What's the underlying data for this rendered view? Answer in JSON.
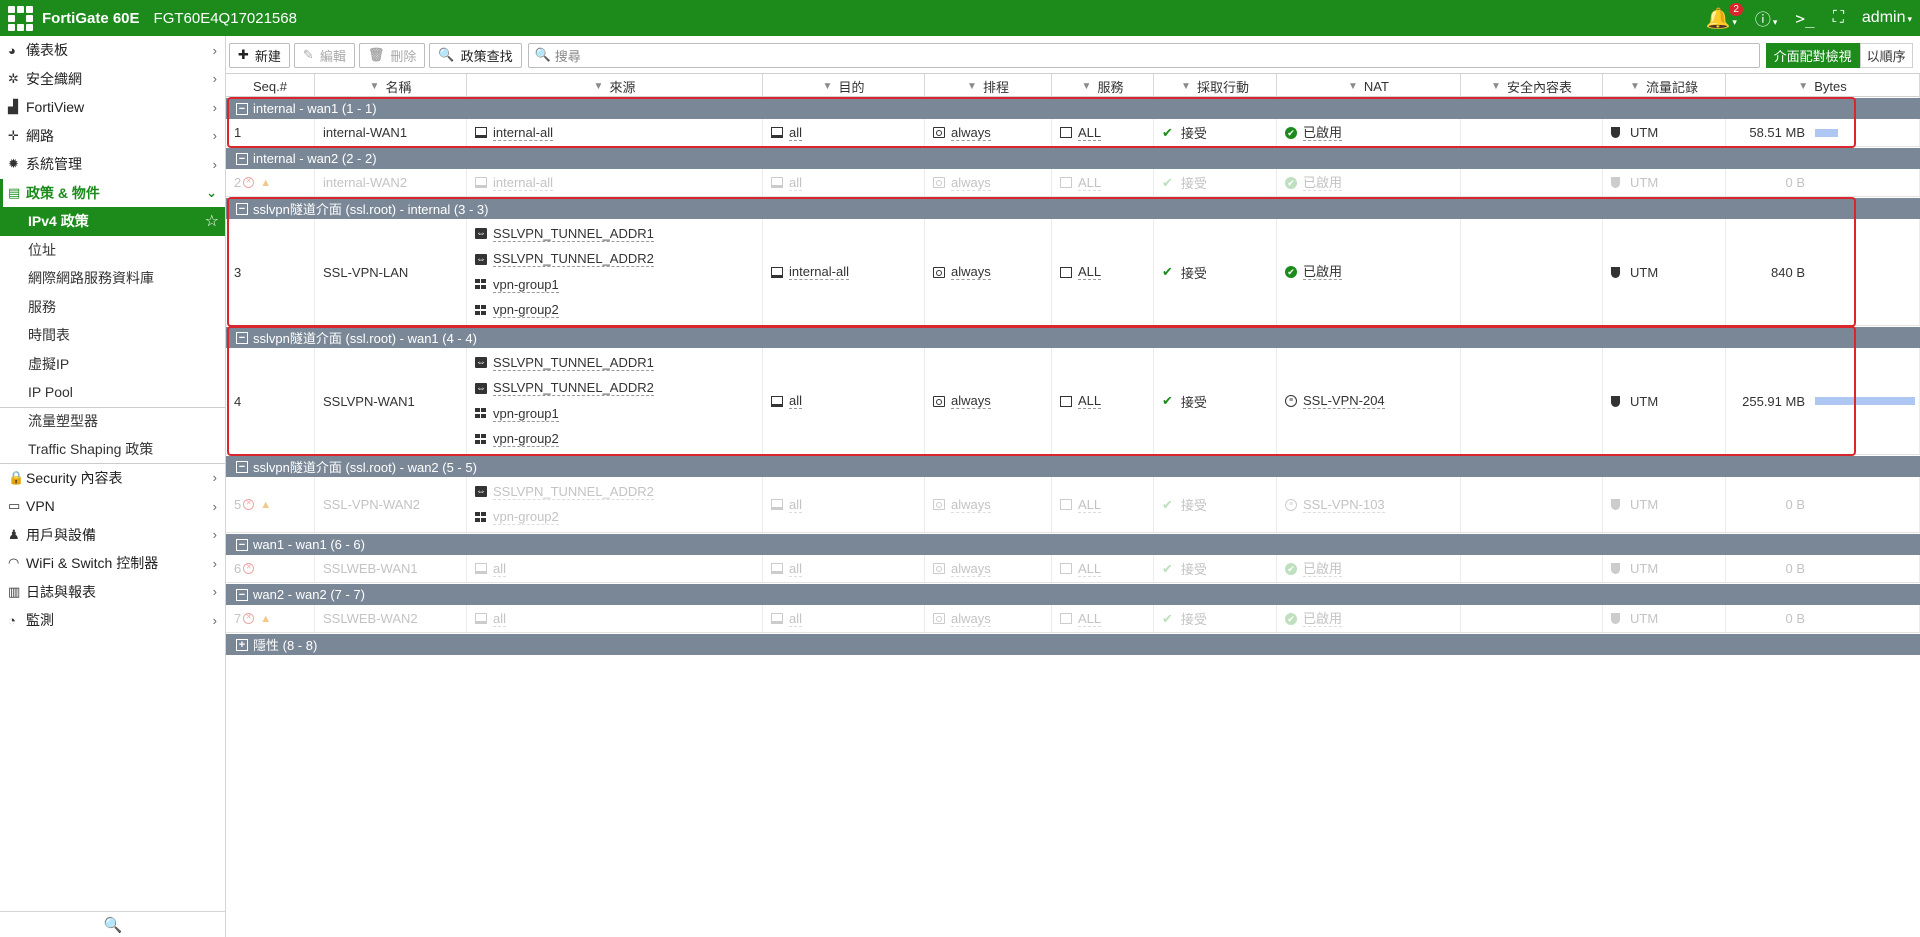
{
  "header": {
    "brand": "FortiGate 60E",
    "serial": "FGT60E4Q17021568",
    "notification_count": "2",
    "user": "admin"
  },
  "sidebar": {
    "items": [
      {
        "label": "儀表板",
        "icon": "dashboard-icon",
        "glyph": "◕"
      },
      {
        "label": "安全織網",
        "icon": "security-fabric-icon",
        "glyph": "✲"
      },
      {
        "label": "FortiView",
        "icon": "fortiview-icon",
        "glyph": "▟"
      },
      {
        "label": "網路",
        "icon": "network-icon",
        "glyph": "✛"
      },
      {
        "label": "系統管理",
        "icon": "system-gear-icon",
        "glyph": "✹"
      },
      {
        "label": "政策 & 物件",
        "icon": "policy-objects-icon",
        "glyph": "▤"
      }
    ],
    "subitems": [
      "IPv4 政策",
      "位址",
      "網際網路服務資料庫",
      "服務",
      "時間表",
      "虛擬IP",
      "IP Pool",
      "流量塑型器",
      "Traffic Shaping 政策"
    ],
    "items_after": [
      {
        "label": "Security 內容表",
        "icon": "lock-icon",
        "glyph": "🔒"
      },
      {
        "label": "VPN",
        "icon": "vpn-monitor-icon",
        "glyph": "▭"
      },
      {
        "label": "用戶與設備",
        "icon": "user-icon",
        "glyph": "♟"
      },
      {
        "label": "WiFi & Switch 控制器",
        "icon": "wifi-icon",
        "glyph": "◠"
      },
      {
        "label": "日誌與報表",
        "icon": "bar-chart-icon",
        "glyph": "▥"
      },
      {
        "label": "監測",
        "icon": "pie-chart-icon",
        "glyph": "◔"
      }
    ]
  },
  "toolbar": {
    "new": "新建",
    "edit": "編輯",
    "delete": "刪除",
    "policy_lookup": "政策查找",
    "search_placeholder": "搜尋",
    "interface_pair_view": "介面配對檢視",
    "by_sequence": "以順序"
  },
  "columns": [
    "Seq.#",
    "名稱",
    "來源",
    "目的",
    "排程",
    "服務",
    "採取行動",
    "NAT",
    "安全內容表",
    "流量記錄",
    "Bytes"
  ],
  "groups": [
    {
      "title": "internal - wan1 (1 - 1)",
      "expanded": true,
      "rows": [
        {
          "seq": "1",
          "disabled": false,
          "warn": false,
          "name": "internal-WAN1",
          "source": [
            {
              "type": "addr",
              "label": "internal-all"
            }
          ],
          "dest": "all",
          "schedule": "always",
          "service": "ALL",
          "action": "接受",
          "nat": "已啟用",
          "nat_type": "enabled",
          "log": "UTM",
          "bytes": "58.51 MB",
          "bytes_bar": 0.23
        }
      ]
    },
    {
      "title": "internal - wan2 (2 - 2)",
      "expanded": true,
      "rows": [
        {
          "seq": "2",
          "disabled": true,
          "warn": true,
          "name": "internal-WAN2",
          "source": [
            {
              "type": "addr",
              "label": "internal-all"
            }
          ],
          "dest": "all",
          "schedule": "always",
          "service": "ALL",
          "action": "接受",
          "nat": "已啟用",
          "nat_type": "enabled",
          "log": "UTM",
          "bytes": "0 B",
          "bytes_bar": 0
        }
      ]
    },
    {
      "title": "sslvpn隧道介面 (ssl.root) - internal (3 - 3)",
      "expanded": true,
      "rows": [
        {
          "seq": "3",
          "disabled": false,
          "warn": false,
          "name": "SSL-VPN-LAN",
          "source": [
            {
              "type": "tunnel",
              "label": "SSLVPN_TUNNEL_ADDR1"
            },
            {
              "type": "tunnel",
              "label": "SSLVPN_TUNNEL_ADDR2"
            },
            {
              "type": "group",
              "label": "vpn-group1"
            },
            {
              "type": "group",
              "label": "vpn-group2"
            }
          ],
          "dest": "internal-all",
          "schedule": "always",
          "service": "ALL",
          "action": "接受",
          "nat": "已啟用",
          "nat_type": "enabled",
          "log": "UTM",
          "bytes": "840 B",
          "bytes_bar": 0
        }
      ]
    },
    {
      "title": "sslvpn隧道介面 (ssl.root) - wan1 (4 - 4)",
      "expanded": true,
      "rows": [
        {
          "seq": "4",
          "disabled": false,
          "warn": false,
          "name": "SSLVPN-WAN1",
          "source": [
            {
              "type": "tunnel",
              "label": "SSLVPN_TUNNEL_ADDR1"
            },
            {
              "type": "tunnel",
              "label": "SSLVPN_TUNNEL_ADDR2"
            },
            {
              "type": "group",
              "label": "vpn-group1"
            },
            {
              "type": "group",
              "label": "vpn-group2"
            }
          ],
          "dest": "all",
          "schedule": "always",
          "service": "ALL",
          "action": "接受",
          "nat": "SSL-VPN-204",
          "nat_type": "pool",
          "log": "UTM",
          "bytes": "255.91 MB",
          "bytes_bar": 1.0
        }
      ]
    },
    {
      "title": "sslvpn隧道介面 (ssl.root) - wan2 (5 - 5)",
      "expanded": true,
      "rows": [
        {
          "seq": "5",
          "disabled": true,
          "warn": true,
          "name": "SSL-VPN-WAN2",
          "source": [
            {
              "type": "tunnel",
              "label": "SSLVPN_TUNNEL_ADDR2"
            },
            {
              "type": "group",
              "label": "vpn-group2"
            }
          ],
          "dest": "all",
          "schedule": "always",
          "service": "ALL",
          "action": "接受",
          "nat": "SSL-VPN-103",
          "nat_type": "pool",
          "log": "UTM",
          "bytes": "0 B",
          "bytes_bar": 0
        }
      ]
    },
    {
      "title": "wan1 - wan1 (6 - 6)",
      "expanded": true,
      "rows": [
        {
          "seq": "6",
          "disabled": true,
          "warn": false,
          "name": "SSLWEB-WAN1",
          "source": [
            {
              "type": "addr",
              "label": "all"
            }
          ],
          "dest": "all",
          "schedule": "always",
          "service": "ALL",
          "action": "接受",
          "nat": "已啟用",
          "nat_type": "enabled",
          "log": "UTM",
          "bytes": "0 B",
          "bytes_bar": 0
        }
      ]
    },
    {
      "title": "wan2 - wan2 (7 - 7)",
      "expanded": true,
      "rows": [
        {
          "seq": "7",
          "disabled": true,
          "warn": true,
          "name": "SSLWEB-WAN2",
          "source": [
            {
              "type": "addr",
              "label": "all"
            }
          ],
          "dest": "all",
          "schedule": "always",
          "service": "ALL",
          "action": "接受",
          "nat": "已啟用",
          "nat_type": "enabled",
          "log": "UTM",
          "bytes": "0 B",
          "bytes_bar": 0
        }
      ]
    },
    {
      "title": "隱性 (8 - 8)",
      "expanded": false,
      "rows": []
    }
  ]
}
